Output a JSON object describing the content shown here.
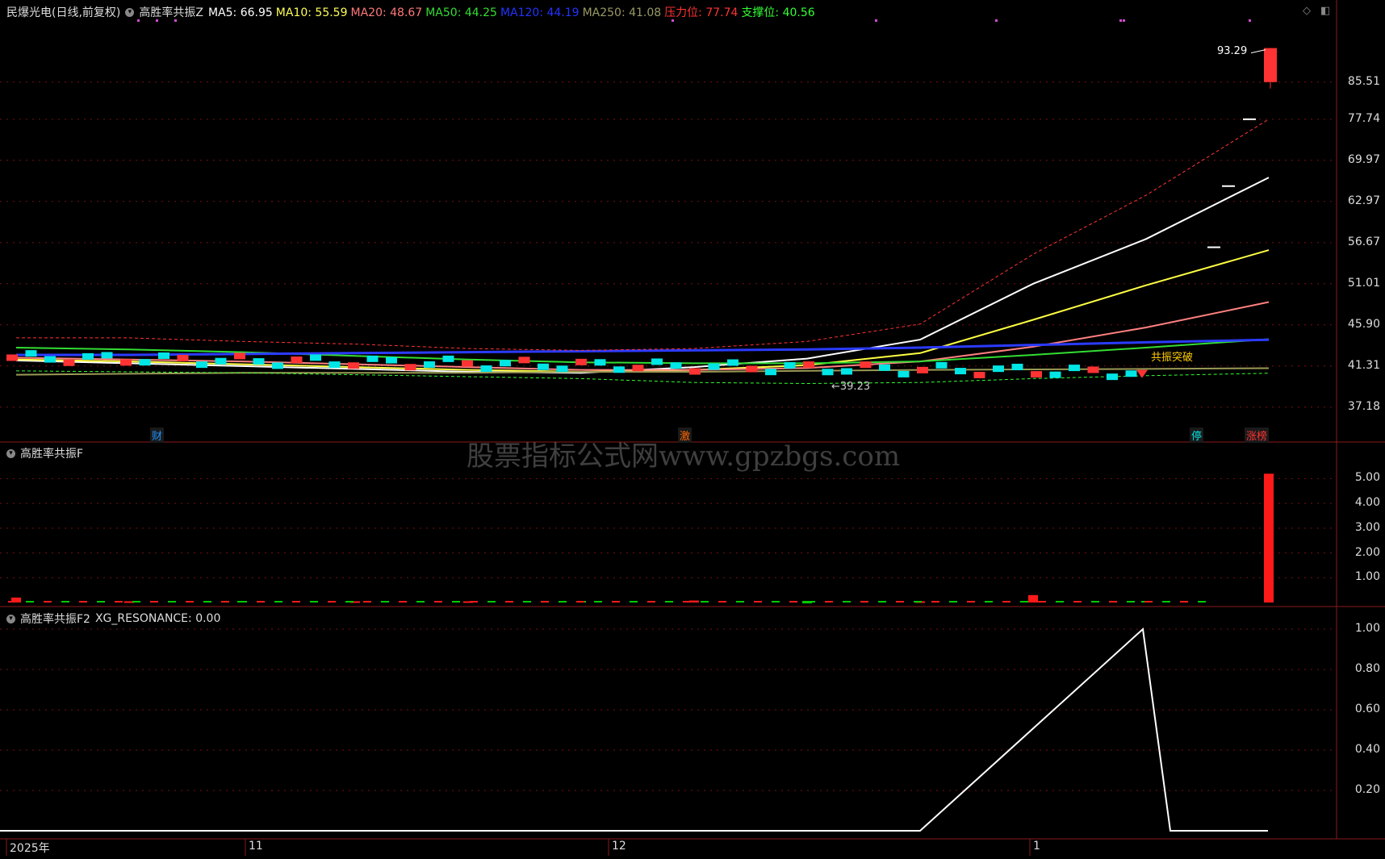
{
  "header_main": {
    "stock": "民爆光电(日线,前复权)",
    "indicator": "高胜率共振Z",
    "items": [
      {
        "label": "MA5: 66.95",
        "color": "#ffffff"
      },
      {
        "label": "MA10: 55.59",
        "color": "#ffff55"
      },
      {
        "label": "MA20: 48.67",
        "color": "#ff7777"
      },
      {
        "label": "MA50: 44.25",
        "color": "#33dd33"
      },
      {
        "label": "MA120: 44.19",
        "color": "#2233ff"
      },
      {
        "label": "MA250: 41.08",
        "color": "#999966"
      },
      {
        "label": "压力位: 77.74",
        "color": "#ff3333"
      },
      {
        "label": "支撑位: 40.56",
        "color": "#33ff33"
      }
    ]
  },
  "header_f": {
    "title": "高胜率共振F"
  },
  "header_f2": {
    "title": "高胜率共振F2",
    "value": "XG_RESONANCE: 0.00"
  },
  "watermark": "股票指标公式网www.gpzbgs.com",
  "badges": [
    "财",
    "激",
    "停",
    "涨榜"
  ],
  "annotations": {
    "high": "93.29",
    "low": "39.23",
    "signal": "共振突破"
  },
  "x_labels": [
    "2025年",
    "11",
    "12",
    "1"
  ],
  "colors": {
    "up": "#ff3333",
    "down": "#00e5e5",
    "volume_up": "#ff1a1a",
    "volume_down": "#00cc00",
    "grid": "#7a1010"
  },
  "chart_data": [
    {
      "type": "line",
      "name": "main_price",
      "y_ticks": [
        "85.51",
        "77.74",
        "69.97",
        "62.97",
        "56.67",
        "51.01",
        "45.90",
        "41.31",
        "37.18"
      ],
      "series": [
        {
          "name": "MA5",
          "values": [
            41.9,
            41.6,
            41.3,
            41.0,
            40.7,
            40.6,
            41.2,
            42.1,
            44.2,
            51.0,
            57.2,
            66.95
          ]
        },
        {
          "name": "MA10",
          "values": [
            42.0,
            41.8,
            41.5,
            41.2,
            40.9,
            40.7,
            40.9,
            41.4,
            42.7,
            46.5,
            50.8,
            55.59
          ]
        },
        {
          "name": "MA20",
          "values": [
            42.2,
            42.0,
            41.8,
            41.5,
            41.2,
            40.9,
            40.9,
            41.1,
            41.8,
            43.4,
            45.6,
            48.67
          ]
        },
        {
          "name": "MA50",
          "values": [
            43.3,
            43.1,
            42.8,
            42.4,
            42.0,
            41.7,
            41.6,
            41.6,
            41.8,
            42.5,
            43.3,
            44.25
          ]
        },
        {
          "name": "MA120",
          "values": [
            42.5,
            42.5,
            42.6,
            42.7,
            42.8,
            42.9,
            43.0,
            43.1,
            43.3,
            43.6,
            43.9,
            44.19
          ]
        },
        {
          "name": "MA250",
          "values": [
            40.4,
            40.5,
            40.6,
            40.6,
            40.6,
            40.7,
            40.7,
            40.8,
            40.9,
            40.95,
            41.0,
            41.08
          ]
        },
        {
          "name": "压力位",
          "values": [
            44.4,
            44.4,
            44.0,
            43.7,
            43.2,
            43.0,
            43.2,
            44.0,
            46.0,
            55.0,
            64.0,
            77.74
          ]
        },
        {
          "name": "支撑位",
          "values": [
            40.8,
            40.7,
            40.6,
            40.4,
            40.2,
            40.0,
            39.6,
            39.5,
            39.6,
            40.0,
            40.3,
            40.56
          ]
        }
      ],
      "last_bar": {
        "open": 85.51,
        "close": 93.29
      }
    },
    {
      "type": "bar",
      "name": "高胜率共振F",
      "y_ticks": [
        "5.00",
        "4.00",
        "3.00",
        "2.00",
        "1.00"
      ],
      "values": [
        0.2,
        0.05,
        -0.05,
        0.05,
        0.05,
        -0.05,
        0.08,
        -0.1,
        0.05,
        0.3,
        -0.05,
        5.2
      ]
    },
    {
      "type": "line",
      "name": "XG_RESONANCE",
      "y_ticks": [
        "1.00",
        "0.80",
        "0.60",
        "0.40",
        "0.20"
      ],
      "values": [
        0,
        0,
        0,
        0,
        0,
        0,
        0,
        0,
        0,
        1,
        0,
        0
      ]
    }
  ]
}
